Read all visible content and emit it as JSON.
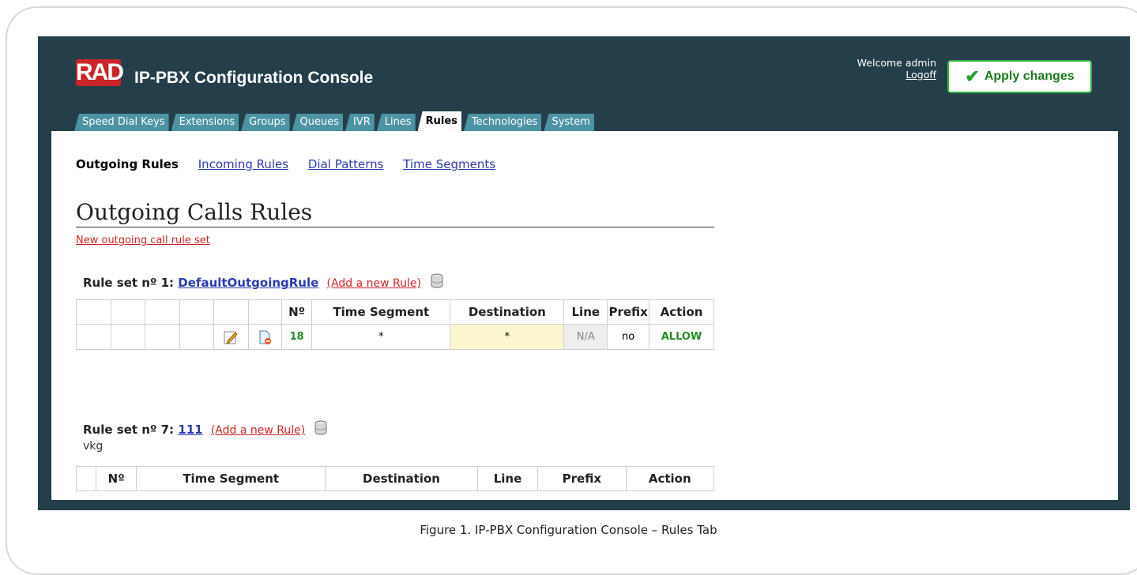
{
  "app": {
    "logo_text": "RAD",
    "title": "IP-PBX Configuration Console",
    "welcome": "Welcome admin",
    "logoff": "Logoff",
    "apply_label": "Apply changes"
  },
  "tabs": [
    {
      "label": "Speed Dial Keys"
    },
    {
      "label": "Extensions"
    },
    {
      "label": "Groups"
    },
    {
      "label": "Queues"
    },
    {
      "label": "IVR"
    },
    {
      "label": "Lines"
    },
    {
      "label": "Rules",
      "active": true
    },
    {
      "label": "Technologies"
    },
    {
      "label": "System"
    }
  ],
  "subnav": {
    "current": "Outgoing Rules",
    "links": [
      "Incoming Rules",
      "Dial Patterns",
      "Time Segments"
    ]
  },
  "page": {
    "title": "Outgoing Calls Rules",
    "new_link": "New outgoing call rule set"
  },
  "ruleset1": {
    "prefix": "Rule set nº 1:",
    "name": "DefaultOutgoingRule",
    "add_link": "(Add a new Rule)",
    "headers": [
      "Nº",
      "Time Segment",
      "Destination",
      "Line",
      "Prefix",
      "Action"
    ],
    "row": {
      "num": "18",
      "time_segment": "*",
      "destination": "*",
      "line": "N/A",
      "prefix": "no",
      "action": "ALLOW"
    }
  },
  "ruleset7": {
    "prefix": "Rule set nº 7:",
    "name": "111",
    "add_link": "(Add a new Rule)",
    "description": "vkg",
    "headers": [
      "Nº",
      "Time Segment",
      "Destination",
      "Line",
      "Prefix",
      "Action"
    ]
  },
  "caption": "Figure 1.  IP-PBX Configuration Console – Rules Tab",
  "colors": {
    "console_bg": "#253f4a",
    "tab_bg": "#4c93a4",
    "link_blue": "#2b3bb3",
    "link_red": "#d42424",
    "allow_green": "#2a8a2a",
    "logo_red": "#c9252b"
  }
}
